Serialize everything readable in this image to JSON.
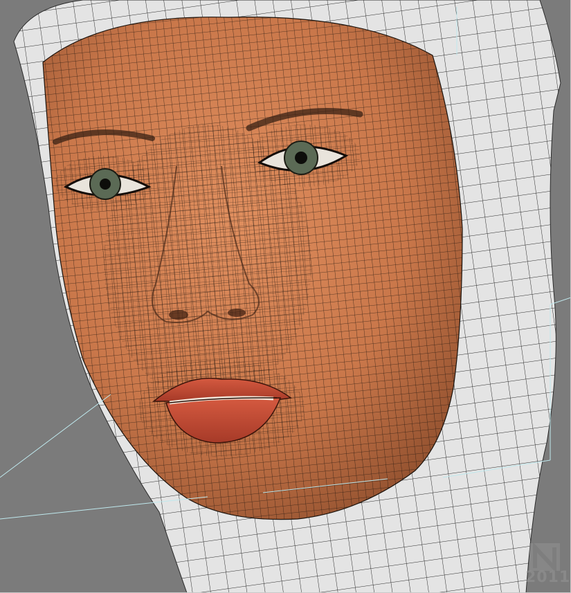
{
  "viewport": {
    "background_color": "#7b7b7b",
    "mesh_color": "#1a120c",
    "skin_color": "#c9774a",
    "hood_color": "#e6e6e6",
    "lip_color": "#c24b35",
    "guide_line_color": "#bfe9ee"
  },
  "watermark": {
    "year": "2011",
    "logo_icon": "n-logo-icon"
  }
}
